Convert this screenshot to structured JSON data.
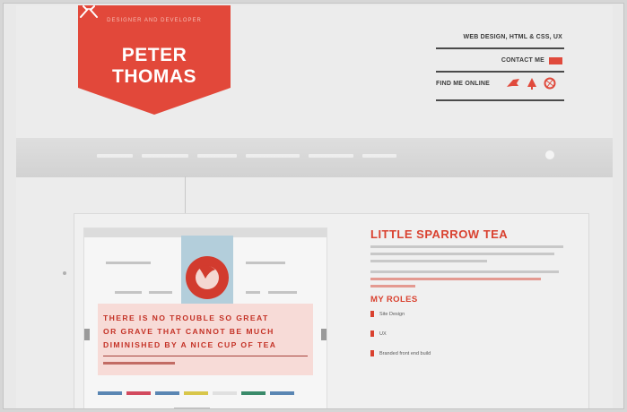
{
  "header": {
    "brand_tagline": "DESIGNER AND DEVELOPER",
    "brand_name": "PETER THOMAS"
  },
  "top_nav": {
    "services": "WEB DESIGN, HTML & CSS, UX",
    "contact": "CONTACT ME",
    "find_online": "FIND ME ONLINE",
    "social_icons": [
      "bird-icon",
      "tree-icon",
      "dribbble-icon"
    ]
  },
  "project": {
    "title": "LITTLE SPARROW TEA",
    "roles_title": "MY ROLES",
    "roles": [
      "Site Design",
      "UX",
      "Branded front end build"
    ],
    "quote_lines": [
      "THERE IS NO TROUBLE SO GREAT",
      "OR GRAVE THAT CANNOT BE MUCH",
      "DIMINISHED BY A NICE CUP OF TEA"
    ]
  },
  "colors": {
    "accent": "#d9412f",
    "banner": "#e2483a",
    "text": "#3a3a3a",
    "swatches": [
      "#5a86b3",
      "#d24a5e",
      "#5a86b3",
      "#d8c64a",
      "#e0e0e0",
      "#3a8a6a",
      "#5a86b3"
    ]
  }
}
